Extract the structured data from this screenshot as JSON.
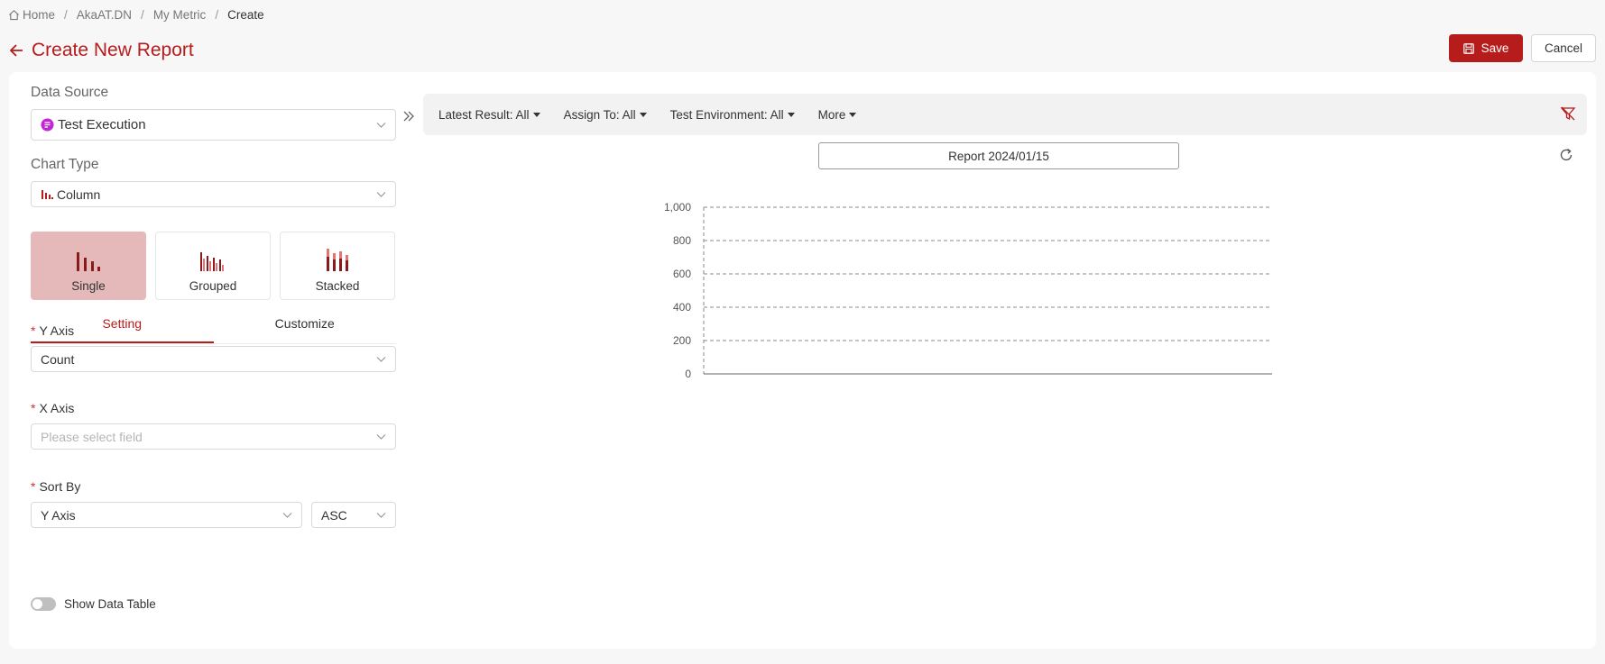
{
  "breadcrumb": {
    "home": "Home",
    "project": "AkaAT.DN",
    "section": "My Metric",
    "current": "Create",
    "separator": "/"
  },
  "header": {
    "title": "Create New Report",
    "save_label": "Save",
    "cancel_label": "Cancel"
  },
  "left": {
    "data_source_label": "Data Source",
    "data_source_value": "Test Execution",
    "chart_type_label": "Chart Type",
    "chart_type_value": "Column",
    "types": [
      "Single",
      "Grouped",
      "Stacked"
    ],
    "selected_type": "Single",
    "tabs": [
      "Setting",
      "Customize"
    ],
    "active_tab": "Setting",
    "y_axis_label": "Y Axis",
    "y_axis_value": "Count",
    "x_axis_label": "X Axis",
    "x_axis_placeholder": "Please select field",
    "sort_by_label": "Sort By",
    "sort_by_value": "Y Axis",
    "sort_order_value": "ASC",
    "show_data_table_label": "Show Data Table",
    "show_data_table_on": false
  },
  "filters": [
    "Latest Result: All",
    "Assign To: All",
    "Test Environment: All",
    "More"
  ],
  "report_name": "Report 2024/01/15",
  "colors": {
    "accent": "#b71c1c",
    "selected_card": "#e5b8ba"
  },
  "chart_data": {
    "type": "bar",
    "categories": [],
    "values": [],
    "title": "",
    "xlabel": "",
    "ylabel": "",
    "ylim": [
      0,
      1000
    ],
    "yticks": [
      "0",
      "200",
      "400",
      "600",
      "800",
      "1,000"
    ],
    "grid": true
  }
}
